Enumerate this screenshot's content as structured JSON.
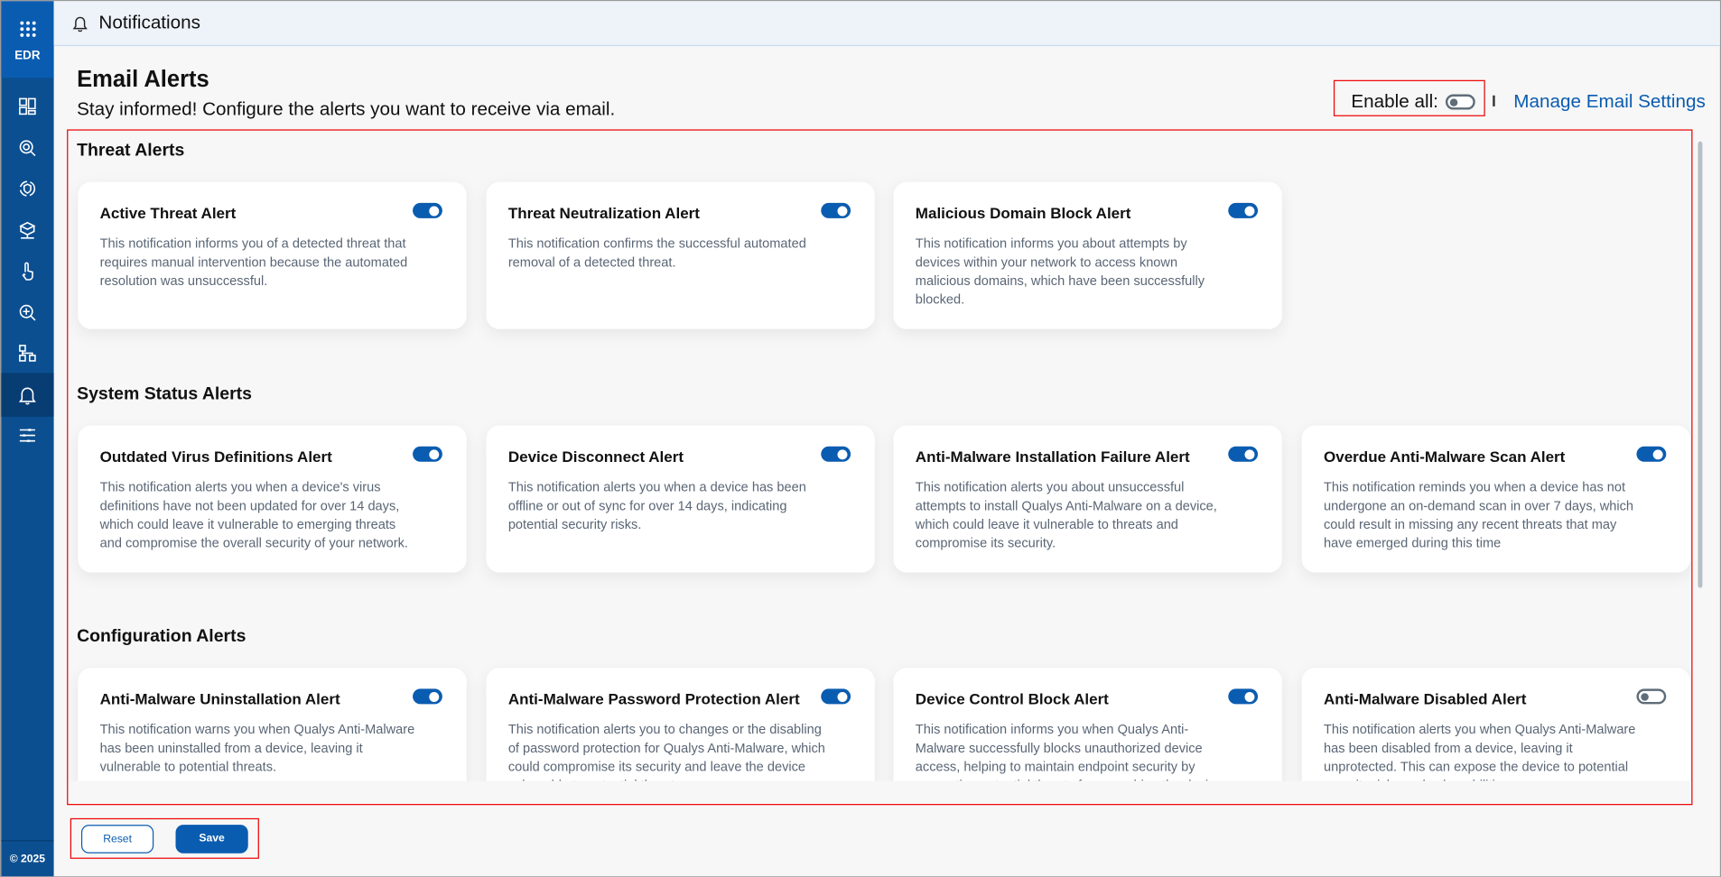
{
  "app": {
    "name": "EDR",
    "copyright": "© 2025"
  },
  "sidebar": {
    "items": [
      {
        "icon": "dashboard-icon"
      },
      {
        "icon": "threat-hunt-icon"
      },
      {
        "icon": "incident-icon"
      },
      {
        "icon": "inventory-icon"
      },
      {
        "icon": "response-icon"
      },
      {
        "icon": "investigation-icon"
      },
      {
        "icon": "hierarchy-icon"
      },
      {
        "icon": "bell-icon",
        "active": true
      },
      {
        "icon": "settings-sliders-icon"
      }
    ]
  },
  "header": {
    "title": "Notifications"
  },
  "page": {
    "title": "Email Alerts",
    "subtitle": "Stay informed! Configure the alerts you want to receive via email.",
    "enable_all_label": "Enable all:",
    "enable_all": false,
    "manage_link": "Manage Email Settings"
  },
  "sections": [
    {
      "title": "Threat Alerts",
      "cards": [
        {
          "title": "Active Threat Alert",
          "enabled": true,
          "desc": "This notification informs you of a detected threat that requires manual intervention because the automated resolution was unsuccessful."
        },
        {
          "title": "Threat Neutralization Alert",
          "enabled": true,
          "desc": "This notification confirms the successful automated removal of a detected threat."
        },
        {
          "title": "Malicious Domain Block Alert",
          "enabled": true,
          "desc": "This notification informs you about attempts by devices within your network to access known malicious domains, which have been successfully blocked."
        }
      ]
    },
    {
      "title": "System Status Alerts",
      "cards": [
        {
          "title": "Outdated Virus Definitions Alert",
          "enabled": true,
          "desc": "This notification alerts you when a device's virus definitions have not been updated for over 14 days, which could leave it vulnerable to emerging threats and compromise the overall security of your network."
        },
        {
          "title": "Device Disconnect Alert",
          "enabled": true,
          "desc": "This notification alerts you when a device has been offline or out of sync for over 14 days, indicating potential security risks."
        },
        {
          "title": "Anti-Malware Installation Failure Alert",
          "enabled": true,
          "desc": "This notification alerts you about unsuccessful attempts to install Qualys Anti-Malware on a device, which could leave it vulnerable to threats and compromise its security."
        },
        {
          "title": "Overdue Anti-Malware Scan Alert",
          "enabled": true,
          "desc": "This notification reminds you when a device has not undergone an on-demand scan in over 7 days, which could result in missing any recent threats that may have emerged during this time"
        }
      ]
    },
    {
      "title": "Configuration Alerts",
      "cards": [
        {
          "title": "Anti-Malware Uninstallation Alert",
          "enabled": true,
          "desc": "This notification warns you when Qualys Anti-Malware has been uninstalled from a device, leaving it vulnerable to potential threats."
        },
        {
          "title": "Anti-Malware Password Protection Alert",
          "enabled": true,
          "desc": "This notification alerts you to changes or the disabling of password protection for Qualys Anti-Malware, which could compromise its security and leave the device vulnerable to potential threats."
        },
        {
          "title": "Device Control Block Alert",
          "enabled": true,
          "desc": "This notification informs you when Qualys Anti-Malware successfully blocks unauthorized device access, helping to maintain endpoint security by preventing potential threats from reaching the device."
        },
        {
          "title": "Anti-Malware Disabled Alert",
          "enabled": false,
          "desc": "This notification alerts you when Qualys Anti-Malware has been disabled from a device, leaving it unprotected. This can expose the device to potential security risks and vulnerabilities."
        }
      ]
    }
  ],
  "footer": {
    "reset_label": "Reset",
    "save_label": "Save"
  }
}
